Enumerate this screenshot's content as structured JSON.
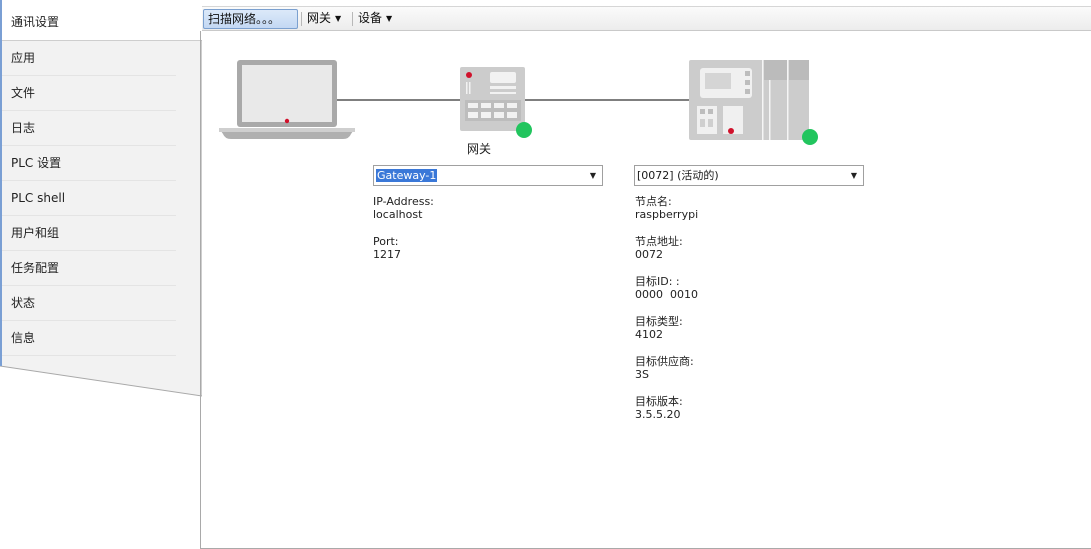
{
  "sidebar": {
    "items": [
      {
        "label": "通讯设置"
      },
      {
        "label": "应用"
      },
      {
        "label": "文件"
      },
      {
        "label": "日志"
      },
      {
        "label": "PLC 设置"
      },
      {
        "label": "PLC shell"
      },
      {
        "label": "用户和组"
      },
      {
        "label": "任务配置"
      },
      {
        "label": "状态"
      },
      {
        "label": "信息"
      }
    ]
  },
  "toolbar": {
    "scan_label": "扫描网络。。。",
    "gateway_label": "网关",
    "device_label": "设备"
  },
  "topology": {
    "gateway_caption": "网关",
    "gateway_status_color": "#22c55e",
    "device_status_color": "#22c55e"
  },
  "gateway_panel": {
    "selected": "Gateway-1",
    "ip_label": "IP-Address:",
    "ip_value": "localhost",
    "port_label": "Port:",
    "port_value": "1217"
  },
  "device_panel": {
    "selected": "[0072] (活动的)",
    "node_name_label": "节点名:",
    "node_name_value": "raspberrypi",
    "node_addr_label": "节点地址:",
    "node_addr_value": "0072",
    "target_id_label": "目标ID: :",
    "target_id_value": "0000  0010",
    "target_type_label": "目标类型:",
    "target_type_value": "4102",
    "vendor_label": "目标供应商:",
    "vendor_value": "3S",
    "version_label": "目标版本:",
    "version_value": "3.5.5.20"
  },
  "colors": {
    "accent": "#3a78d8",
    "status_online": "#22c55e",
    "sidebar_bg": "#f2f2f2"
  }
}
